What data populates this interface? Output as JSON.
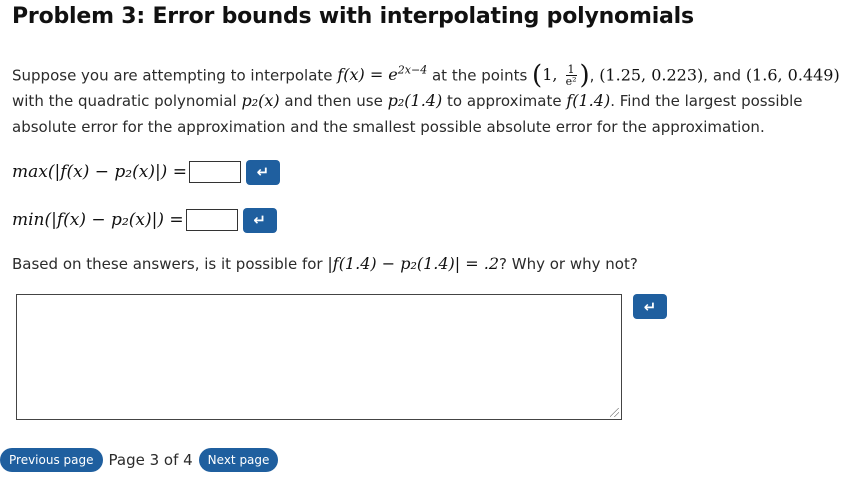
{
  "title": "Problem 3: Error bounds with interpolating polynomials",
  "intro": {
    "t1": "Suppose you are attempting to interpolate ",
    "f_def": "f(x) = e",
    "exp": "2x−4",
    "t2": " at the points ",
    "p1_a": "1, ",
    "p1_num": "1",
    "p1_den": "e²",
    "t3": ", ",
    "p2": "(1.25, 0.223)",
    "t4": ", and ",
    "p3": "(1.6, 0.449)",
    "t5": " with the quadratic polynomial ",
    "p2x": "p₂(x)",
    "t6": " and then use ",
    "p2_14": "p₂(1.4)",
    "t7": " to approximate ",
    "f14": "f(1.4)",
    "t8": ". Find the largest possible absolute error for the approximation and the smallest possible absolute error for the approximation."
  },
  "max_label": "max(|f(x) − p₂(x)|) =",
  "min_label": "min(|f(x) − p₂(x)|) =",
  "submit_icon": "↵",
  "question": {
    "t1": "Based on these answers, is it possible for ",
    "expr": "|f(1.4) − p₂(1.4)| = .2",
    "t2": "? Why or why not?"
  },
  "pager": {
    "prev": "Previous page",
    "label": "Page 3 of 4",
    "next": "Next page"
  },
  "colors": {
    "button": "#1f5f9f"
  },
  "icons": {
    "submit": "return-arrow-icon",
    "resize": "resize-handle-icon"
  }
}
